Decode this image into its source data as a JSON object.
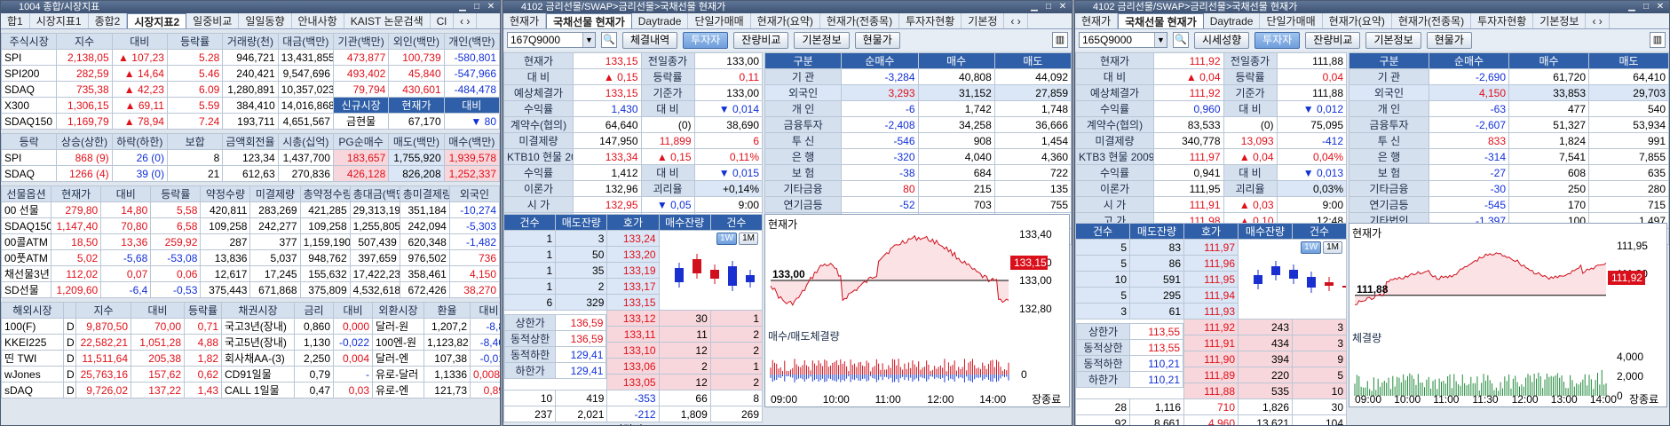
{
  "w1": {
    "title": "1004 종합/시장지표",
    "tabs": [
      "합1",
      "시장지표1",
      "종합2",
      "시장지표2",
      "일중비교",
      "일일동향",
      "안내사항",
      "KAIST 논문검색",
      "Cl"
    ],
    "active": 3,
    "t1": {
      "head": [
        "주식시장",
        "지수",
        "대비",
        "등락률",
        "거래량(천)",
        "대금(백만)",
        "기관(백만)",
        "외인(백만)",
        "개인(백만)"
      ],
      "rows": [
        [
          "SPI",
          "2,138,05",
          "▲",
          "107,23",
          "5.28",
          "946,721",
          "13,431,855",
          "473,877",
          "100,739",
          "-580,801"
        ],
        [
          "SPI200",
          "282,59",
          "▲",
          "14,64",
          "5.46",
          "240,421",
          "9,547,696",
          "493,402",
          "45,840",
          "-547,966"
        ],
        [
          "SDAQ",
          "735,38",
          "▲",
          "42,23",
          "6.09",
          "1,280,891",
          "10,357,023",
          "79,794",
          "430,601",
          "-484,478"
        ],
        [
          "X300",
          "1,306,15",
          "▲",
          "69,11",
          "5.59",
          "384,410",
          "14,016,868",
          "신규시장",
          "현재가",
          "대비"
        ],
        [
          "SDAQ150",
          "1,169,79",
          "▲",
          "78,94",
          "7.24",
          "193,711",
          "4,651,567",
          "금현물",
          "67,170",
          "▼",
          "80"
        ]
      ]
    },
    "t2": {
      "head": [
        "등락",
        "상승(상한)",
        "하락(하한)",
        "보합",
        "금액회전율",
        "시총(십억)",
        "PG순매수",
        "매도(백만)",
        "매수(백만)"
      ],
      "rows": [
        [
          "SPI",
          "868 (9)",
          "26 (0)",
          "8",
          "123,34",
          "1,437,700",
          "183,657",
          "1,755,920",
          "1,939,578"
        ],
        [
          "SDAQ",
          "1266 (4)",
          "39 (0)",
          "21",
          "612,63",
          "270,836",
          "426,128",
          "826,208",
          "1,252,337"
        ]
      ]
    },
    "t3": {
      "head": [
        "선물옵션",
        "현재가",
        "대비",
        "등락률",
        "약정수량",
        "미결제량",
        "총약정수량",
        "총대금(백만)",
        "총미결제량",
        "외국인"
      ],
      "rows": [
        [
          "00 선물",
          "279,80",
          "14,80",
          "5,58",
          "420,811",
          "283,269",
          "421,285",
          "29,313,191",
          "351,184",
          "-10,274"
        ],
        [
          "SDAQ150 선물",
          "1,147,40",
          "70,80",
          "6,58",
          "109,258",
          "242,277",
          "109,258",
          "1,255,805",
          "242,094",
          "-5,303"
        ],
        [
          "00콜ATM",
          "18,50",
          "13,36",
          "259,92",
          "287",
          "377",
          "1,159,190",
          "507,439",
          "620,348",
          "-1,482"
        ],
        [
          "00풋ATM",
          "5,02",
          "-5,68",
          "-53,08",
          "13,836",
          "5,037",
          "948,762",
          "397,659",
          "976,502",
          "736"
        ],
        [
          "채선물3년",
          "112,02",
          "0,07",
          "0,06",
          "12,617",
          "17,245",
          "155,632",
          "17,422,232",
          "358,461",
          "4,150"
        ],
        [
          "SD선물",
          "1,209,60",
          "-6,4",
          "-0,53",
          "375,443",
          "671,868",
          "375,809",
          "4,532,618",
          "672,426",
          "38,270"
        ]
      ]
    },
    "t4": {
      "head": [
        "해외시장",
        "",
        "지수",
        "대비",
        "등락률"
      ],
      "head2": [
        "채권시장",
        "금리",
        "대비"
      ],
      "head3": [
        "외환시장",
        "환율",
        "대비"
      ],
      "rows": [
        [
          "100(F)",
          "D",
          "9,870,50",
          "70,00",
          "0,71",
          "국고3년(장내)",
          "0,860",
          "0,000",
          "달러-원",
          "1,207,2",
          "-8,8"
        ],
        [
          "KKEI225",
          "D",
          "22,582,21",
          "1,051,28",
          "4,88",
          "국고5년(장내)",
          "1,130",
          "-0,022",
          "100엔-원",
          "1,123,82",
          "-8,40"
        ],
        [
          "띤 TWI",
          "D",
          "11,511,64",
          "205,38",
          "1,82",
          "회사채AA-(3)",
          "2,250",
          "0,004",
          "달러-엔",
          "107,38",
          "-0,01"
        ],
        [
          "wJones",
          "D",
          "25,763,16",
          "157,62",
          "0,62",
          "CD91일물",
          "0,79",
          "-",
          "유로-달러",
          "1,1336",
          "0,0083"
        ],
        [
          "sDAQ",
          "D",
          "9,726,02",
          "137,22",
          "1,43",
          "CALL 1일물",
          "0,47",
          "0,03",
          "유로-엔",
          "121,73",
          "0,89"
        ]
      ]
    }
  },
  "w2": {
    "title": "4102 금리선물/SWAP>금리선물>국채선물 현재가",
    "tabs": [
      "현재가",
      "국채선물 현재가",
      "Daytrade",
      "단일가매매",
      "현재가(요약)",
      "현재가(전종목)",
      "투자자현황",
      "기본정"
    ],
    "active": 1,
    "code": "167Q9000",
    "btns": [
      "체결내역",
      "투자자",
      "잔량비교",
      "기본정보",
      "현물가"
    ],
    "btn_on": 1,
    "info": [
      [
        "현재가",
        "133,15",
        "전일종가",
        "133,00"
      ],
      [
        "대 비",
        "▲ 0,15",
        "등락률",
        "0,11"
      ],
      [
        "예상체결가",
        "133,15",
        "기준가",
        "133,00"
      ],
      [
        "수익률",
        "1,430",
        "대 비",
        "▼ 0,014"
      ],
      [
        "계약수(협의)",
        "64,640",
        "(0)",
        "38,690"
      ],
      [
        "미결제량",
        "147,950",
        "11,899",
        "6"
      ],
      [
        "KTB10 현물 20",
        "133,34",
        "▲ 0,15",
        "0,11%"
      ],
      [
        "수익률",
        "1,412",
        "대 비",
        "▼ 0,015"
      ],
      [
        "이론가",
        "132,96",
        "괴리율",
        "+0,14%"
      ],
      [
        "시 가",
        "132,95",
        "▼ 0,05",
        "9:00"
      ],
      [
        "고 가",
        "133,38",
        "▲ 0,38",
        "12:10"
      ],
      [
        "저 가",
        "132,80",
        "▼ 0,20",
        "9:32"
      ]
    ],
    "inv_head": [
      "구분",
      "순매수",
      "매수",
      "매도"
    ],
    "inv": [
      [
        "기 관",
        "-3,284",
        "40,808",
        "44,092"
      ],
      [
        "외국인",
        "3,293",
        "31,152",
        "27,859"
      ],
      [
        "개 인",
        "-6",
        "1,742",
        "1,748"
      ],
      [
        "금융투자",
        "-2,408",
        "34,258",
        "36,666"
      ],
      [
        "투 신",
        "-546",
        "908",
        "1,454"
      ],
      [
        "은 행",
        "-320",
        "4,040",
        "4,360"
      ],
      [
        "보 험",
        "-38",
        "684",
        "722"
      ],
      [
        "기타금융",
        "80",
        "215",
        "135"
      ],
      [
        "연기금등",
        "-52",
        "703",
        "755"
      ],
      [
        "기타법인",
        "-3",
        "3",
        "6"
      ],
      [
        "합 계",
        "0",
        "73,705",
        "73,705"
      ]
    ],
    "ob_head": [
      "건수",
      "매도잔량",
      "호가",
      "매수잔량",
      "건수"
    ],
    "asks": [
      [
        "1",
        "3",
        "133,24"
      ],
      [
        "1",
        "50",
        "133,20"
      ],
      [
        "1",
        "35",
        "133,19"
      ],
      [
        "1",
        "2",
        "133,17"
      ],
      [
        "6",
        "329",
        "133,15"
      ]
    ],
    "bids": [
      [
        "133,12",
        "30",
        "1"
      ],
      [
        "133,11",
        "11",
        "2"
      ],
      [
        "133,10",
        "12",
        "2"
      ],
      [
        "133,06",
        "2",
        "1"
      ],
      [
        "133,05",
        "12",
        "2"
      ]
    ],
    "limits": [
      [
        "상한가",
        "136,59"
      ],
      [
        "동적상한",
        "136,59"
      ],
      [
        "동적하한",
        "129,41"
      ],
      [
        "하한가",
        "129,41"
      ]
    ],
    "ob_tot": [
      [
        "10",
        "419",
        "-353",
        "66",
        "8"
      ],
      [
        "237",
        "2,021",
        "-212",
        "1,809",
        "269"
      ]
    ],
    "ob_foot": "잔량비교",
    "chart": {
      "title": "현재가",
      "sub": "매수/매도체결량",
      "ticks": [
        "133,40",
        "133,20",
        "133,00",
        "132,80"
      ],
      "last": "133,15",
      "ref": "133,00",
      "times": [
        "09:00",
        "10:00",
        "11:00",
        "12:00",
        "14:00",
        "장종료"
      ],
      "zero": "0",
      "modes": [
        "1W",
        "1M"
      ]
    }
  },
  "w3": {
    "title": "4102 금리선물/SWAP>금리선물>국채선물 현재가",
    "tabs": [
      "현재가",
      "국채선물 현재가",
      "Daytrade",
      "단일가매매",
      "현재가(요약)",
      "현재가(전종목)",
      "투자자현황",
      "기본정보"
    ],
    "active": 1,
    "code": "165Q9000",
    "btns": [
      "시세성향",
      "투자자",
      "잔량비교",
      "기본정보",
      "현물가"
    ],
    "btn_on": 1,
    "info": [
      [
        "현재가",
        "111,92",
        "전일종가",
        "111,88"
      ],
      [
        "대 비",
        "▲ 0,04",
        "등락률",
        "0,04"
      ],
      [
        "예상체결가",
        "111,92",
        "기준가",
        "111,88"
      ],
      [
        "수익률",
        "0,960",
        "대 비",
        "▼ 0,012"
      ],
      [
        "계약수(협의)",
        "83,533",
        "(0)",
        "75,095"
      ],
      [
        "미결제량",
        "340,778",
        "13,093",
        "-412"
      ],
      [
        "KTB3 현물 2009",
        "111,97",
        "▲ 0,04",
        "0,04%"
      ],
      [
        "수익률",
        "0,941",
        "대 비",
        "▼ 0,013"
      ],
      [
        "이론가",
        "111,95",
        "괴리율",
        "0,03%"
      ],
      [
        "시 가",
        "111,91",
        "▲ 0,03",
        "9:00"
      ],
      [
        "고 가",
        "111,98",
        "▲ 0,10",
        "12:48"
      ],
      [
        "저 가",
        "111,86",
        "▼ 0,02",
        "9:31"
      ]
    ],
    "inv_head": [
      "구분",
      "순매수",
      "매수",
      "매도"
    ],
    "inv": [
      [
        "기 관",
        "-2,690",
        "61,720",
        "64,410"
      ],
      [
        "외국인",
        "4,150",
        "33,853",
        "29,703"
      ],
      [
        "개 인",
        "-63",
        "477",
        "540"
      ],
      [
        "금융투자",
        "-2,607",
        "51,327",
        "53,934"
      ],
      [
        "투 신",
        "833",
        "1,824",
        "991"
      ],
      [
        "은 행",
        "-314",
        "7,541",
        "7,855"
      ],
      [
        "보 험",
        "-27",
        "608",
        "635"
      ],
      [
        "기타금융",
        "-30",
        "250",
        "280"
      ],
      [
        "연기금등",
        "-545",
        "170",
        "715"
      ],
      [
        "기타법인",
        "-1,397",
        "100",
        "1,497"
      ],
      [
        "합 계",
        "0",
        "96,150",
        "96,150"
      ]
    ],
    "ob_head": [
      "건수",
      "매도잔량",
      "호가",
      "매수잔량",
      "건수"
    ],
    "asks": [
      [
        "5",
        "83",
        "111,97"
      ],
      [
        "5",
        "86",
        "111,96"
      ],
      [
        "10",
        "591",
        "111,95"
      ],
      [
        "5",
        "295",
        "111,94"
      ],
      [
        "3",
        "61",
        "111,93"
      ]
    ],
    "bids": [
      [
        "111,92",
        "243",
        "3"
      ],
      [
        "111,91",
        "434",
        "3"
      ],
      [
        "111,90",
        "394",
        "9"
      ],
      [
        "111,89",
        "220",
        "5"
      ],
      [
        "111,88",
        "535",
        "10"
      ]
    ],
    "limits": [
      [
        "상한가",
        "113,55"
      ],
      [
        "동적상한",
        "113,55"
      ],
      [
        "동적하한",
        "110,21"
      ],
      [
        "하한가",
        "110,21"
      ]
    ],
    "ob_tot": [
      [
        "28",
        "1,116",
        "710",
        "1,826",
        "30"
      ],
      [
        "92",
        "8,661",
        "4,960",
        "13,621",
        "104"
      ]
    ],
    "ob_foot": "자래비교",
    "chart": {
      "title": "현재가",
      "sub": "체결량",
      "ticks": [
        "111,95",
        "111,90"
      ],
      "last": "111,92",
      "ref": "111,88",
      "times": [
        "09:00",
        "10:00",
        "11:00",
        "11:30",
        "12:00",
        "13:00",
        "14:00",
        "장종료"
      ],
      "vticks": [
        "4,000",
        "2,000",
        "0"
      ],
      "modes": [
        "1W",
        "1M"
      ]
    }
  }
}
